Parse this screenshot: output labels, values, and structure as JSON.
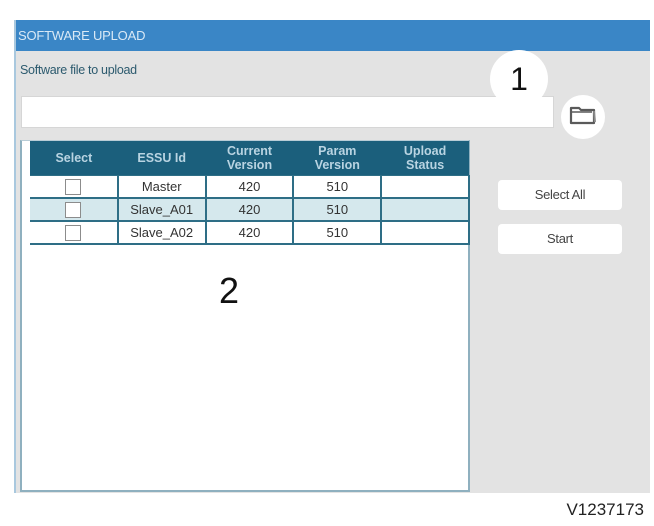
{
  "window": {
    "title": "SOFTWARE UPLOAD"
  },
  "file_section": {
    "label": "Software file to upload",
    "input_value": "",
    "browse_icon": "folder-icon"
  },
  "callouts": {
    "one": "1",
    "two": "2"
  },
  "table": {
    "columns": [
      {
        "line1": "Select",
        "line2": ""
      },
      {
        "line1": "ESSU Id",
        "line2": ""
      },
      {
        "line1": "Current",
        "line2": "Version"
      },
      {
        "line1": "Param",
        "line2": "Version"
      },
      {
        "line1": "Upload",
        "line2": "Status"
      }
    ],
    "rows": [
      {
        "selected": false,
        "essu_id": "Master",
        "current_version": "420",
        "param_version": "510",
        "upload_status": ""
      },
      {
        "selected": false,
        "essu_id": "Slave_A01",
        "current_version": "420",
        "param_version": "510",
        "upload_status": ""
      },
      {
        "selected": false,
        "essu_id": "Slave_A02",
        "current_version": "420",
        "param_version": "510",
        "upload_status": ""
      }
    ]
  },
  "buttons": {
    "select_all": "Select All",
    "start": "Start"
  },
  "colors": {
    "titlebar": "#3a86c6",
    "table_header": "#1b5f7c",
    "row_alt": "#d5e8ed",
    "panel_bg": "#e3e3e3"
  },
  "reference_code": "V1237173"
}
